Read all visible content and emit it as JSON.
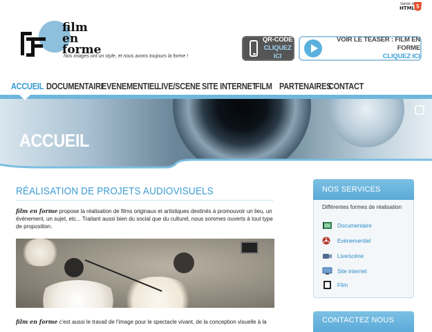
{
  "header": {
    "html5_badge_top": "Validé le",
    "html5_badge_label": "HTML",
    "html5_badge_number": "5",
    "logo_text": [
      "film",
      "en",
      "forme"
    ],
    "tagline": "Nos images ont un style, et nous avons toujours la forme !",
    "qr_button": {
      "line1": "QR-CODE",
      "line2": "CLIQUEZ ICI"
    },
    "teaser_button": {
      "line1": "VOIR LE TEASER : FILM EN FORME",
      "line2": "CLIQUEZ ICI"
    }
  },
  "nav": {
    "items": [
      {
        "label": "ACCUEIL",
        "active": true
      },
      {
        "label": "DOCUMENTAIRE"
      },
      {
        "label": "EVENEMENTIEL"
      },
      {
        "label": "LIVE/SCENE"
      },
      {
        "label": "SITE INTERNET"
      },
      {
        "label": "FILM"
      },
      {
        "label": "PARTENAIRES"
      },
      {
        "label": "CONTACT"
      }
    ]
  },
  "banner": {
    "title": "ACCUEIL"
  },
  "main": {
    "section_title": "RÉALISATION DE PROJETS AUDIOVISUELS",
    "intro_brand": "film en forme",
    "intro_text": " propose la réalisation de films originaux et artistiques destinés à promouvoir un lieu, un événement, un sujet, etc... Traitant aussi bien du social que du culturel, nous sommes ouverts à tout type de proposition.",
    "tail_brand": "film en forme",
    "tail_text": " c'est aussi le travail de l'image pour le spectacle vivant, de la conception visuelle à la"
  },
  "sidebar": {
    "title": "NOS SERVICES",
    "subtitle": "Différentes formes de réalisation",
    "services": [
      {
        "label": "Documentaire",
        "icon": "film-strip-icon"
      },
      {
        "label": "Evènementiel",
        "icon": "film-reel-icon"
      },
      {
        "label": "Live/scène",
        "icon": "camera-icon"
      },
      {
        "label": "Site internet",
        "icon": "monitor-icon"
      },
      {
        "label": "Film",
        "icon": "film-icon"
      }
    ],
    "second_title": "CONTACTEZ NOUS"
  },
  "colors": {
    "accent": "#3a9bd3",
    "sidebar_head": "#6bb5de",
    "dark_button": "#555555"
  }
}
